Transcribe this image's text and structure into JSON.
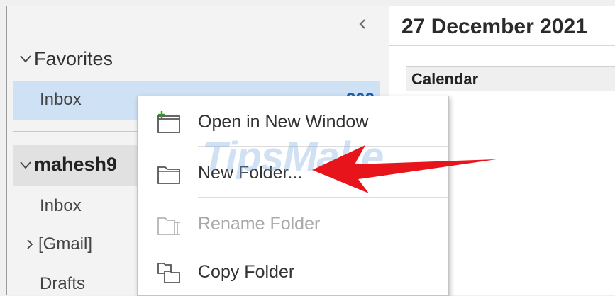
{
  "nav": {
    "favorites_label": "Favorites",
    "favorites_inbox": {
      "label": "Inbox",
      "count": "302"
    },
    "account_label": "mahesh9",
    "folders": [
      "Inbox",
      "Drafts"
    ],
    "gmail_label": "[Gmail]"
  },
  "calendar": {
    "date": "27 December 2021",
    "header": "Calendar"
  },
  "context_menu": {
    "items": [
      {
        "label": "Open in New Window",
        "icon": "open-new-window-icon",
        "enabled": true
      },
      {
        "label": "New Folder...",
        "icon": "new-folder-icon",
        "enabled": true
      },
      {
        "label": "Rename Folder",
        "icon": "rename-folder-icon",
        "enabled": false
      },
      {
        "label": "Copy Folder",
        "icon": "copy-folder-icon",
        "enabled": true
      }
    ]
  },
  "watermark": {
    "text": "TipsMake",
    "suffix": ".com"
  },
  "colors": {
    "selected": "#cfe1f4",
    "arrow": "#e8141c",
    "count": "#1a5fb0",
    "accent_plus": "#2ca02c"
  }
}
